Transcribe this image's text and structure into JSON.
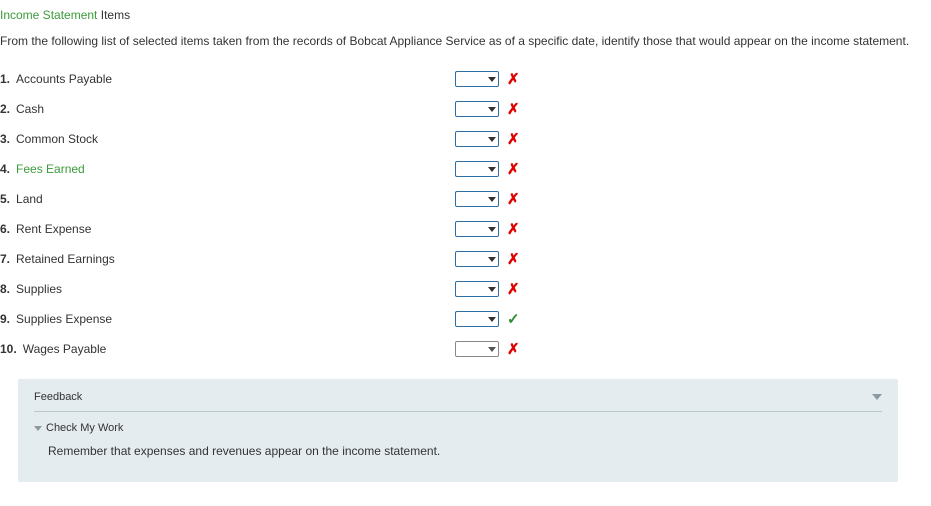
{
  "title": {
    "green": "Income Statement",
    "black": "Items"
  },
  "instructions": "From the following list of selected items taken from the records of Bobcat Appliance Service as of a specific date, identify those that would appear on the income statement.",
  "items": [
    {
      "num": "1.",
      "text": "Accounts Payable",
      "green": false,
      "status": "wrong",
      "plain": false
    },
    {
      "num": "2.",
      "text": "Cash",
      "green": false,
      "status": "wrong",
      "plain": false
    },
    {
      "num": "3.",
      "text": "Common Stock",
      "green": false,
      "status": "wrong",
      "plain": false
    },
    {
      "num": "4.",
      "text": "Fees Earned",
      "green": true,
      "status": "wrong",
      "plain": false
    },
    {
      "num": "5.",
      "text": "Land",
      "green": false,
      "status": "wrong",
      "plain": false
    },
    {
      "num": "6.",
      "text": "Rent Expense",
      "green": false,
      "status": "wrong",
      "plain": false
    },
    {
      "num": "7.",
      "text": "Retained Earnings",
      "green": false,
      "status": "wrong",
      "plain": false
    },
    {
      "num": "8.",
      "text": "Supplies",
      "green": false,
      "status": "wrong",
      "plain": false
    },
    {
      "num": "9.",
      "text": "Supplies Expense",
      "green": false,
      "status": "right",
      "plain": false
    },
    {
      "num": "10.",
      "text": "Wages Payable",
      "green": false,
      "status": "wrong",
      "plain": true
    }
  ],
  "feedback": {
    "title": "Feedback",
    "check_label": "Check My Work",
    "text": "Remember that expenses and revenues appear on the income statement."
  },
  "glyphs": {
    "wrong": "✗",
    "right": "✓"
  }
}
